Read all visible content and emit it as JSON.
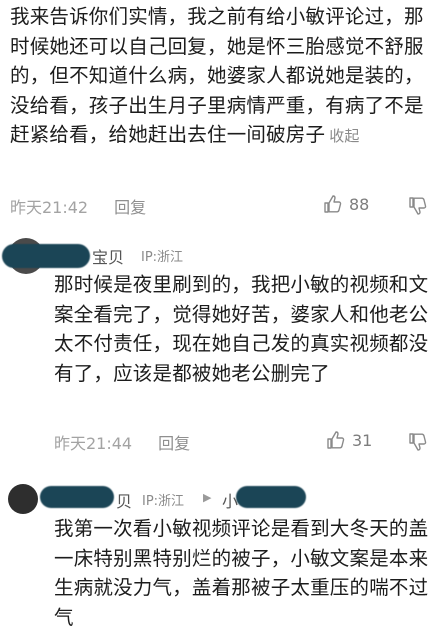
{
  "comment1": {
    "text": "我来告诉你们实情，我之前有给小敏评论过，那时候她还可以自己回复，她是怀三胎感觉不舒服的，但不知道什么病，她婆家人都说她是装的，没给看，孩子出生月子里病情严重，有病了不是赶紧给看，给她赶出去住一间破房子",
    "fold_label": "收起",
    "time": "昨天21:42",
    "reply_label": "回复",
    "likes": "88"
  },
  "comment2": {
    "username_suffix": "宝贝",
    "ip": "IP:浙江",
    "text": "那时候是夜里刷到的，我把小敏的视频和文案全看完了，觉得她好苦，婆家人和他老公太不付责任，现在她自己发的真实视频都没有了，应该是都被她老公删完了",
    "time": "昨天21:44",
    "reply_label": "回复",
    "likes": "31"
  },
  "comment3": {
    "username_suffix": "贝",
    "ip": "IP:浙江",
    "reply_to_prefix": "小",
    "text": "我第一次看小敏视频评论是看到大冬天的盖一床特别黑特别烂的被子，小敏文案是本来生病就没力气，盖着那被子太重压的喘不过气"
  },
  "colors": {
    "text": "#1c1c1c",
    "meta": "#a3a3a3",
    "redaction": "#1f4a5a"
  },
  "icons": {
    "like": "thumbs-up-icon",
    "dislike": "thumbs-down-icon",
    "reply_arrow": "reply-arrow-icon"
  }
}
